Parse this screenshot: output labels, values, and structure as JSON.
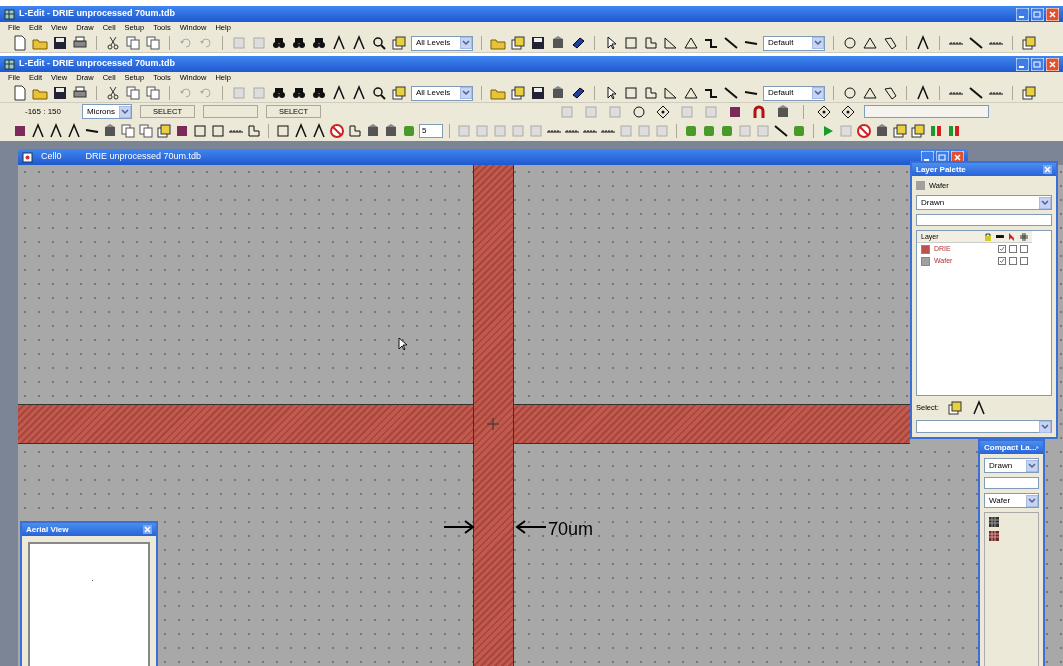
{
  "app_windows": [
    {
      "title": "L-Edit - DRIE unprocessed 70um.tdb",
      "menu": [
        "File",
        "Edit",
        "View",
        "Draw",
        "Cell",
        "Setup",
        "Tools",
        "Window",
        "Help"
      ],
      "level_dropdown": "All Levels",
      "style_dropdown": "Default"
    },
    {
      "title": "L-Edit - DRIE unprocessed 70um.tdb",
      "menu": [
        "File",
        "Edit",
        "View",
        "Draw",
        "Cell",
        "Setup",
        "Tools",
        "Window",
        "Help"
      ],
      "level_dropdown": "All Levels",
      "style_dropdown": "Default"
    }
  ],
  "status_bar": {
    "coordinates": "-165 : 150",
    "units": "Microns",
    "mode_left": "SELECT",
    "mode_right": "SELECT"
  },
  "edit_toolbar": {
    "step_value": "5"
  },
  "cell_window": {
    "cell": "Cell0",
    "file": "DRIE unprocessed 70um.tdb"
  },
  "canvas": {
    "dimension_label": "70um"
  },
  "layer_palette": {
    "title": "Layer Palette",
    "current_layer": "Wafer",
    "view": "Drawn",
    "column": "Layer",
    "select_label": "Select:",
    "layers": [
      {
        "name": "DRIE",
        "color": "#c0504d",
        "checks": [
          true,
          false,
          false
        ]
      },
      {
        "name": "Wafer",
        "color": "#a0a0a0",
        "checks": [
          true,
          false,
          false
        ]
      }
    ]
  },
  "compact_palette": {
    "title": "Compact La...",
    "view": "Drawn",
    "layer": "Wafer"
  },
  "aerial_view": {
    "title": "Aerial View"
  }
}
